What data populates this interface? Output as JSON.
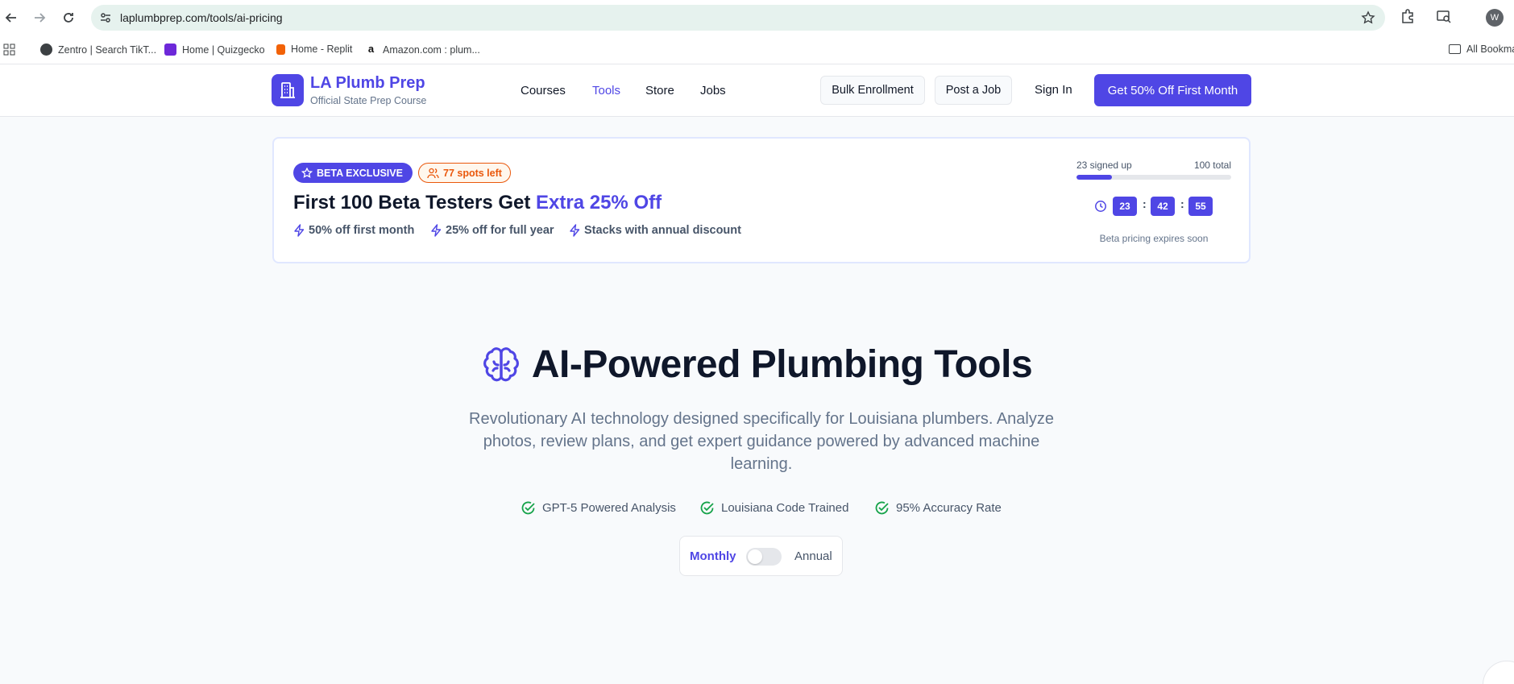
{
  "browser": {
    "url": "laplumbprep.com/tools/ai-pricing",
    "profile_initial": "W",
    "bookmarks": [
      {
        "label": "Zentro | Search TikT...",
        "icon": "globe-icon"
      },
      {
        "label": "Home | Quizgecko",
        "icon": "quizgecko-icon"
      },
      {
        "label": "Home - Replit",
        "icon": "replit-icon"
      },
      {
        "label": "Amazon.com : plum...",
        "icon": "amazon-icon"
      }
    ],
    "all_bookmarks_label": "All Bookmarks"
  },
  "header": {
    "brand": "LA Plumb Prep",
    "tagline": "Official State Prep Course",
    "nav": [
      {
        "label": "Courses",
        "active": false
      },
      {
        "label": "Tools",
        "active": true
      },
      {
        "label": "Store",
        "active": false
      },
      {
        "label": "Jobs",
        "active": false
      }
    ],
    "bulk_enrollment": "Bulk Enrollment",
    "post_job": "Post a Job",
    "sign_in": "Sign In",
    "cta": "Get 50% Off First Month"
  },
  "beta": {
    "badge": "BETA EXCLUSIVE",
    "spots": "77 spots left",
    "title_main": "First 100 Beta Testers Get ",
    "title_accent": "Extra 25% Off",
    "features": [
      "50% off first month",
      "25% off for full year",
      "Stacks with annual discount"
    ],
    "signed_up_label": "23 signed up",
    "total_label": "100 total",
    "progress_fraction": 0.23,
    "timer": {
      "hours": "23",
      "minutes": "42",
      "seconds": "55"
    },
    "expires": "Beta pricing expires soon"
  },
  "hero": {
    "title": "AI-Powered Plumbing Tools",
    "description": "Revolutionary AI technology designed specifically for Louisiana plumbers. Analyze photos, review plans, and get expert guidance powered by advanced machine learning.",
    "checks": [
      "GPT-5 Powered Analysis",
      "Louisiana Code Trained",
      "95% Accuracy Rate"
    ],
    "billing_toggle": {
      "monthly": "Monthly",
      "annual": "Annual",
      "selected": "Monthly"
    }
  },
  "colors": {
    "accent": "#4f46e5",
    "orange": "#ea580c",
    "green": "#16a34a"
  }
}
